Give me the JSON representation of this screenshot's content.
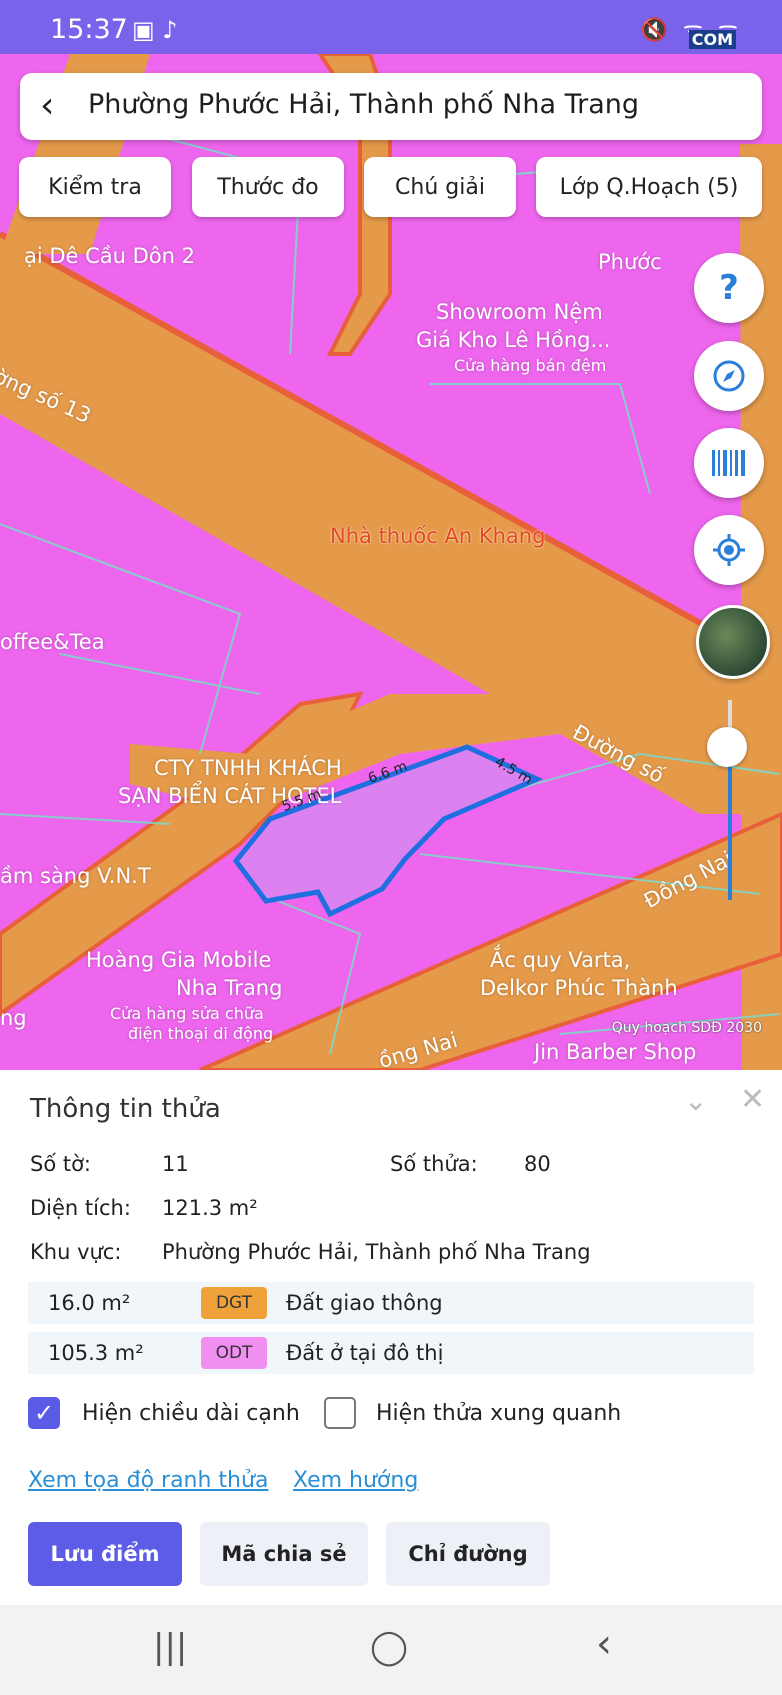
{
  "status": {
    "time": "15:37",
    "left_icons": "▣ ♪",
    "right_icons": "🔇 ᯤ ᯤ",
    "watermark": "COM"
  },
  "search": {
    "back_icon": "chevron-left",
    "title": "Phường Phước Hải, Thành phố Nha Trang"
  },
  "toolbar": {
    "check": "Kiểm tra",
    "measure": "Thước đo",
    "legend": "Chú giải",
    "layers": "Lớp Q.Hoạch (5)"
  },
  "map": {
    "labels": {
      "de_cau": "ại Dê Cầu Dôn 2",
      "duong_13": "ờng số 13",
      "phuoc": "Phước",
      "showroom1": "Showroom Nệm",
      "showroom2": "Giá Kho Lê Hồng...",
      "showroom3": "Cửa hàng bán đệm",
      "nha_thuoc": "Nhà thuốc An Khang",
      "coffee": "offee&Tea",
      "duong_so": "Đường số",
      "cty1": "CTY TNHH KHÁCH",
      "cty2": "SẠN BIỂN CÁT HOTEL",
      "tam_sang": "ầm sàng V.N.T",
      "dong_nai1": "Đồng Nai",
      "hoang_gia1": "Hoàng Gia Mobile",
      "hoang_gia2": "Nha Trang",
      "hoang_gia3": "Cửa hàng sửa chữa",
      "hoang_gia4": "điện thoại di động",
      "acquy1": "Ắc quy Varta,",
      "acquy2": "Delkor Phúc Thành",
      "jin": "Jin Barber Shop",
      "dong_nai2": "ồng Nai",
      "ng": "ng"
    },
    "dims": {
      "d1": "5.5 m",
      "d2": "6.6 m",
      "d3": "4.5 m"
    },
    "attribution": "Quy hoạch SDĐ 2030",
    "colors": {
      "residential": "#ee66ee",
      "road": "#e59a4a",
      "parcel": "#1f6fe0"
    }
  },
  "sheet": {
    "title": "Thông tin thửa",
    "so_to_label": "Số tờ:",
    "so_to": "11",
    "so_thua_label": "Số thửa:",
    "so_thua": "80",
    "dien_tich_label": "Diện tích:",
    "dien_tich": "121.3 m²",
    "khu_vuc_label": "Khu vực:",
    "khu_vuc": "Phường Phước Hải, Thành phố Nha Trang",
    "land_uses": [
      {
        "area": "16.0 m²",
        "code": "DGT",
        "name": "Đất giao thông",
        "color": "#f0a23a"
      },
      {
        "area": "105.3 m²",
        "code": "ODT",
        "name": "Đất ở tại đô thị",
        "color": "#f08ff0"
      }
    ],
    "show_edges": "Hiện chiều dài cạnh",
    "show_neighbors": "Hiện thửa xung quanh",
    "link_coords": "Xem tọa độ ranh thửa",
    "link_direction": "Xem hướng",
    "save": "Lưu điểm",
    "share": "Mã chia sẻ",
    "directions": "Chỉ đường"
  },
  "nav": {
    "recent": "|||",
    "home": "◯",
    "back": "‹"
  }
}
